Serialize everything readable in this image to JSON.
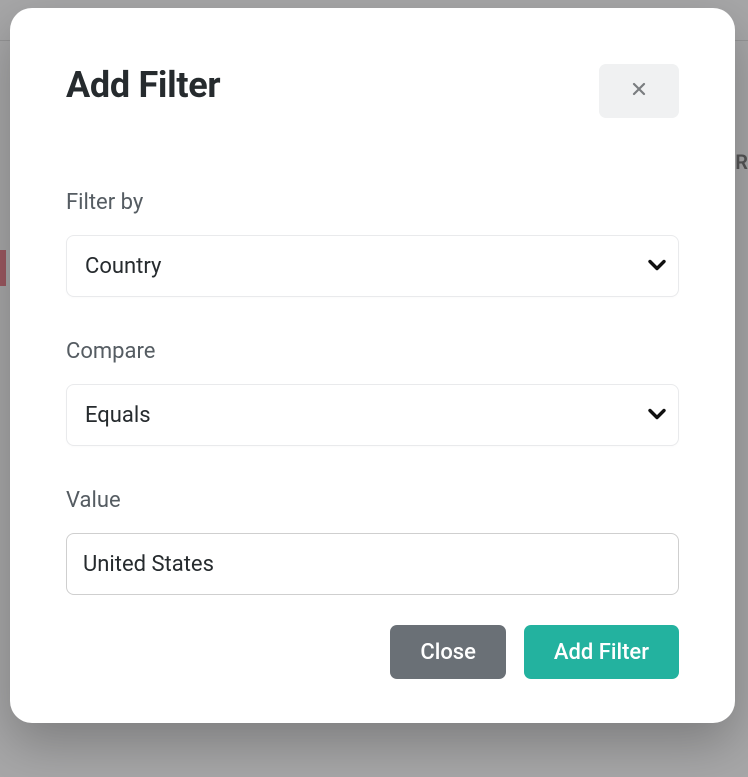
{
  "backdrop": {
    "partial_column_text": "R"
  },
  "modal": {
    "title": "Add Filter",
    "fields": {
      "filter_by": {
        "label": "Filter by",
        "value": "Country"
      },
      "compare": {
        "label": "Compare",
        "value": "Equals"
      },
      "value": {
        "label": "Value",
        "value": "United States"
      }
    },
    "buttons": {
      "close": "Close",
      "submit": "Add Filter"
    }
  },
  "colors": {
    "primary": "#23b29f",
    "secondary": "#6a7076",
    "text_dark": "#262b2e",
    "text_muted": "#555c62"
  }
}
